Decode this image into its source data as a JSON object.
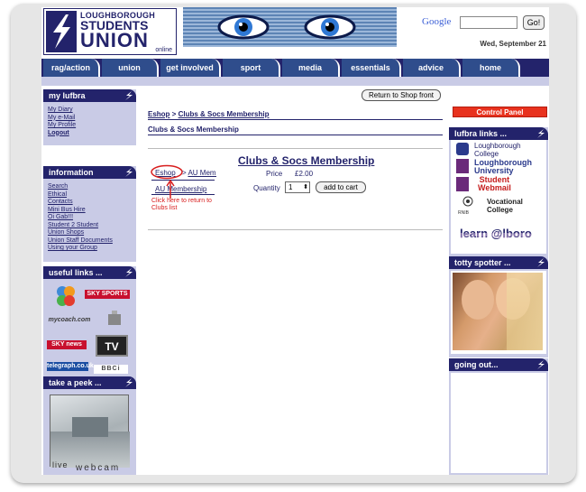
{
  "header": {
    "logo_line1": "LOUGHBOROUGH",
    "logo_line2": "STUDENTS",
    "logo_line3": "UNION",
    "logo_line4": "online",
    "google_label": "Google",
    "go_label": "Go!",
    "date": "Wed, September 21"
  },
  "nav": {
    "tabs": [
      "rag/action",
      "union",
      "get involved",
      "sport",
      "media",
      "essentials",
      "advice",
      "home"
    ]
  },
  "my_lufbra": {
    "title": "my lufbra",
    "links": [
      "My Diary",
      "My e-Mail",
      "My Profile",
      "Logout"
    ]
  },
  "information": {
    "title": "information",
    "links": [
      "Search",
      "Ethical",
      "Contacts",
      "Mini Bus Hire",
      "Oi Gab!!!",
      "Student 2 Student",
      "Union Shops",
      "Union Staff Documents",
      "Using your Group"
    ]
  },
  "useful_links": {
    "title": "useful links ...",
    "logos": [
      "SKY SPORTS",
      "mycoach.com",
      "SKY news",
      "TV",
      "telegraph.co.uk",
      "BBCi"
    ]
  },
  "take_a_peek": {
    "title": "take a peek ...",
    "caption_live": "live",
    "caption_webcam": "webcam"
  },
  "main": {
    "return_button": "Return to Shop front",
    "breadcrumb_eshop": "Eshop",
    "breadcrumb_sep": " > ",
    "breadcrumb_current": "Clubs & Socs Membership",
    "category_title": "Clubs & Socs Membership",
    "product_title": "Clubs & Socs Membership",
    "price_label": "Price",
    "price_value": "£2.00",
    "quantity_label": "Quantity",
    "quantity_value": "1",
    "add_to_cart": "add to cart",
    "mini_eshop": "Eshop",
    "mini_au_memb": "AU Memb",
    "mini_au_membership": "AU Membership",
    "annotation": "Click here to return to Clubs list"
  },
  "right": {
    "control_panel": "Control Panel",
    "lufbra_links_title": "lufbra links ...",
    "college_line1": "Loughborough",
    "college_line2": "College",
    "university_line1": "Loughborough",
    "university_line2": "University",
    "webmail_line1": "Student",
    "webmail_line2": "Webmail",
    "vocational_line1": "Vocational",
    "vocational_line2": "College",
    "rnib": "RNIB",
    "learn": "learn @lboro",
    "totty_title": "totty spotter ...",
    "going_out_title": "going out..."
  },
  "colors": {
    "navy": "#23236b",
    "tab_blue": "#2f4d8c",
    "panel_lilac": "#c9cbe6",
    "control_red": "#e8321e",
    "annotation_red": "#d81e1e"
  }
}
